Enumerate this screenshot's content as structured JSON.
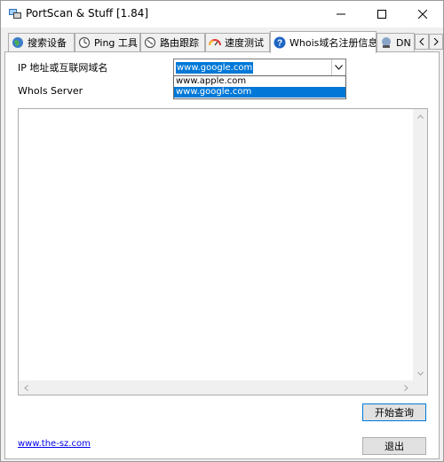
{
  "window": {
    "title": "PortScan & Stuff [1.84]"
  },
  "tabs": [
    {
      "label": "搜索设备",
      "icon": "globe-icon"
    },
    {
      "label": "Ping 工具",
      "icon": "ping-icon"
    },
    {
      "label": "路由跟踪",
      "icon": "trace-icon"
    },
    {
      "label": "速度测试",
      "icon": "speed-gauge-icon"
    },
    {
      "label": "Whois域名注册信息",
      "icon": "question-icon",
      "active": true
    },
    {
      "label": "DN",
      "icon": "dns-icon"
    }
  ],
  "whois": {
    "ip_label": "IP 地址或互联网域名",
    "server_label": "WhoIs Server",
    "combo_value": "www.google.com",
    "dropdown_items": [
      "www.apple.com",
      "www.google.com"
    ],
    "selected_index": 1,
    "output_text": ""
  },
  "buttons": {
    "start": "开始查询",
    "exit": "退出"
  },
  "footer": {
    "link": "www.the-sz.com"
  },
  "colors": {
    "accent": "#0078d7",
    "link": "#0000ee"
  }
}
